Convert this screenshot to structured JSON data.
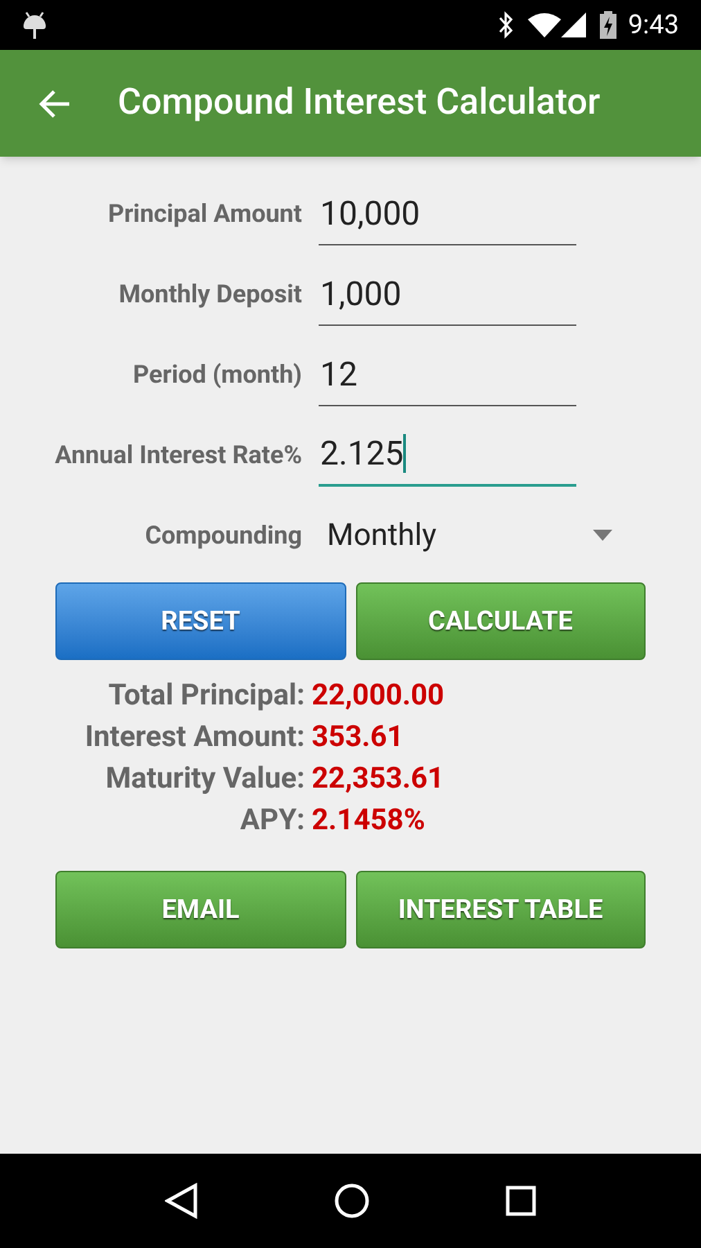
{
  "status_bar": {
    "time": "9:43"
  },
  "app_bar": {
    "title": "Compound Interest Calculator"
  },
  "fields": [
    {
      "label": "Principal Amount",
      "value": "10,000",
      "focused": false
    },
    {
      "label": "Monthly Deposit",
      "value": "1,000",
      "focused": false
    },
    {
      "label": "Period (month)",
      "value": "12",
      "focused": false
    },
    {
      "label": "Annual Interest Rate%",
      "value": "2.125",
      "focused": true
    }
  ],
  "compounding": {
    "label": "Compounding",
    "value": "Monthly"
  },
  "action_buttons": [
    {
      "label": "RESET",
      "kind": "blue"
    },
    {
      "label": "CALCULATE",
      "kind": "green"
    }
  ],
  "results": [
    {
      "label": "Total Principal:",
      "value": "22,000.00"
    },
    {
      "label": "Interest Amount:",
      "value": "353.61"
    },
    {
      "label": "Maturity Value:",
      "value": "22,353.61"
    },
    {
      "label": "APY:",
      "value": "2.1458%"
    }
  ],
  "bottom_buttons": [
    {
      "label": "EMAIL",
      "kind": "green"
    },
    {
      "label": "INTEREST TABLE",
      "kind": "green"
    }
  ]
}
